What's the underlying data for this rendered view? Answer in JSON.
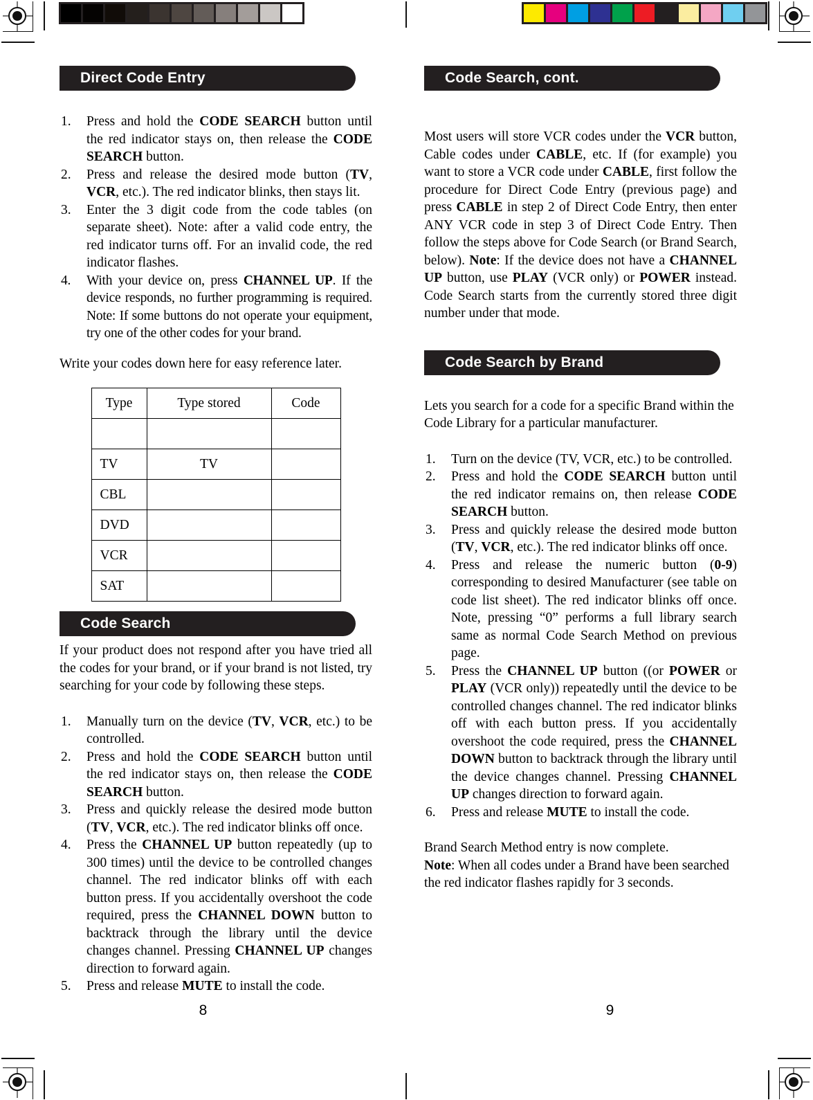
{
  "press": {
    "grayscale_patches": [
      "#000000",
      "#050302",
      "#110c08",
      "#241f1c",
      "#3b3430",
      "#4e4641",
      "#635c58",
      "#867f7c",
      "#a39d9a",
      "#cbc7c4",
      "#ffffff"
    ],
    "color_patches": [
      "#fdea00",
      "#e6007e",
      "#009fe3",
      "#2e3192",
      "#00a14b",
      "#ed1c24",
      "#231f20",
      "#fbeda0",
      "#f4a7c4",
      "#6fcff0",
      "#939598"
    ]
  },
  "left_page": {
    "page_number": "8",
    "sections": [
      {
        "heading": "Direct Code Entry",
        "steps": [
          {
            "num": "1.",
            "parts": [
              {
                "t": "Press and hold the ",
                "b": false
              },
              {
                "t": "CODE SEARCH",
                "b": true
              },
              {
                "t": " button until the red indicator stays on, then release the ",
                "b": false
              },
              {
                "t": "CODE SEARCH",
                "b": true
              },
              {
                "t": " button.",
                "b": false
              }
            ]
          },
          {
            "num": "2.",
            "parts": [
              {
                "t": "Press and release the desired mode button (",
                "b": false
              },
              {
                "t": "TV",
                "b": true
              },
              {
                "t": ", ",
                "b": false
              },
              {
                "t": "VCR",
                "b": true
              },
              {
                "t": ", etc.). The red indicator blinks, then stays lit.",
                "b": false
              }
            ]
          },
          {
            "num": "3.",
            "parts": [
              {
                "t": "Enter the 3 digit code from the code tables (on separate sheet). Note: after a valid code entry, the red indicator turns off.  For an invalid code, the red indicator flashes.",
                "b": false
              }
            ]
          },
          {
            "num": "4.",
            "parts": [
              {
                "t": "With your device on, press ",
                "b": false
              },
              {
                "t": "CHANNEL UP",
                "b": true
              },
              {
                "t": ". If the device responds, no further programming is required. Note: If some buttons do not operate your equipment, try one of the other codes for your brand.",
                "b": false
              }
            ]
          }
        ],
        "after_text": "Write your codes down here for easy reference later.",
        "table": {
          "headers": [
            "Type",
            "Type  stored",
            "Code"
          ],
          "rows": [
            [
              "",
              "",
              ""
            ],
            [
              "TV",
              "TV",
              ""
            ],
            [
              "CBL",
              "",
              ""
            ],
            [
              "DVD",
              "",
              ""
            ],
            [
              "VCR",
              "",
              ""
            ],
            [
              "SAT",
              "",
              ""
            ]
          ]
        }
      },
      {
        "heading": "Code Search",
        "intro": "If your product does not respond after you have tried all the codes for your brand, or if your brand is not listed, try searching for your code by following these steps.",
        "steps": [
          {
            "num": "1.",
            "parts": [
              {
                "t": "Manually turn on the device (",
                "b": false
              },
              {
                "t": "TV",
                "b": true
              },
              {
                "t": ", ",
                "b": false
              },
              {
                "t": "VCR",
                "b": true
              },
              {
                "t": ", etc.) to be controlled.",
                "b": false
              }
            ]
          },
          {
            "num": "2.",
            "parts": [
              {
                "t": "Press and hold the ",
                "b": false
              },
              {
                "t": "CODE SEARCH",
                "b": true
              },
              {
                "t": " button until the red indicator stays on, then release the ",
                "b": false
              },
              {
                "t": "CODE SEARCH",
                "b": true
              },
              {
                "t": " button.",
                "b": false
              }
            ]
          },
          {
            "num": "3.",
            "parts": [
              {
                "t": "Press and quickly release the desired mode button (",
                "b": false
              },
              {
                "t": "TV",
                "b": true
              },
              {
                "t": ", ",
                "b": false
              },
              {
                "t": "VCR",
                "b": true
              },
              {
                "t": ", etc.). The red indicator blinks off once.",
                "b": false
              }
            ]
          },
          {
            "num": "4.",
            "parts": [
              {
                "t": "Press the ",
                "b": false
              },
              {
                "t": "CHANNEL UP",
                "b": true
              },
              {
                "t": " button repeatedly (up to 300 times) until the device to be controlled changes channel. The red indicator blinks off with each button press.  If you accidentally overshoot the code required, press the ",
                "b": false
              },
              {
                "t": "CHANNEL DOWN",
                "b": true
              },
              {
                "t": " button to backtrack through the library until the device changes channel. Pressing ",
                "b": false
              },
              {
                "t": "CHANNEL UP",
                "b": true
              },
              {
                "t": " changes direction to forward again.",
                "b": false
              }
            ]
          },
          {
            "num": "5.",
            "parts": [
              {
                "t": "Press and release ",
                "b": false
              },
              {
                "t": "MUTE",
                "b": true
              },
              {
                "t": " to install the code.",
                "b": false
              }
            ]
          }
        ]
      }
    ]
  },
  "right_page": {
    "page_number": "9",
    "sections": [
      {
        "heading": "Code Search, cont.",
        "paragraph": [
          {
            "t": "Most users will store VCR codes under the ",
            "b": false
          },
          {
            "t": "VCR",
            "b": true
          },
          {
            "t": " button, Cable codes under ",
            "b": false
          },
          {
            "t": "CABLE",
            "b": true
          },
          {
            "t": ", etc. If (for example) you want to store a VCR code under ",
            "b": false
          },
          {
            "t": "CABLE",
            "b": true
          },
          {
            "t": ", first follow the procedure for Direct Code Entry (previous page) and press ",
            "b": false
          },
          {
            "t": "CABLE",
            "b": true
          },
          {
            "t": " in step 2 of Direct Code Entry, then enter ANY VCR code in step 3 of Direct Code Entry. Then follow the steps above for Code Search (or Brand Search, below). ",
            "b": false
          },
          {
            "t": "Note",
            "b": true
          },
          {
            "t": ":  If the device does not have a ",
            "b": false
          },
          {
            "t": "CHANNEL UP",
            "b": true
          },
          {
            "t": " button, use ",
            "b": false
          },
          {
            "t": "PLAY",
            "b": true
          },
          {
            "t": " (VCR only) or ",
            "b": false
          },
          {
            "t": "POWER",
            "b": true
          },
          {
            "t": " instead. Code Search starts from the currently stored three digit number under that mode.",
            "b": false
          }
        ]
      },
      {
        "heading": "Code Search by Brand",
        "intro": "Lets you search for a code for a specific Brand within the Code Library for a particular manufacturer.",
        "steps": [
          {
            "num": "1.",
            "parts": [
              {
                "t": "Turn on the device (TV, VCR, etc.) to be controlled.",
                "b": false
              }
            ]
          },
          {
            "num": "2.",
            "parts": [
              {
                "t": "Press and hold the ",
                "b": false
              },
              {
                "t": "CODE SEARCH",
                "b": true
              },
              {
                "t": " button until the red indicator remains on, then release ",
                "b": false
              },
              {
                "t": "CODE SEARCH",
                "b": true
              },
              {
                "t": " button.",
                "b": false
              }
            ]
          },
          {
            "num": "3.",
            "parts": [
              {
                "t": "Press and quickly release the desired mode button (",
                "b": false
              },
              {
                "t": "TV",
                "b": true
              },
              {
                "t": ", ",
                "b": false
              },
              {
                "t": "VCR",
                "b": true
              },
              {
                "t": ", etc.). The red indicator blinks off once.",
                "b": false
              }
            ]
          },
          {
            "num": "4.",
            "parts": [
              {
                "t": "Press and release the numeric button (",
                "b": false
              },
              {
                "t": "0-9",
                "b": true
              },
              {
                "t": ") corresponding to desired Manufacturer (see table on code list sheet).  The red indicator blinks off once. Note, pressing “0” performs a full library search same as normal Code Search Method on previous page.",
                "b": false
              }
            ]
          },
          {
            "num": "5.",
            "parts": [
              {
                "t": "Press the ",
                "b": false
              },
              {
                "t": "CHANNEL UP",
                "b": true
              },
              {
                "t": " button ((or ",
                "b": false
              },
              {
                "t": "POWER",
                "b": true
              },
              {
                "t": " or ",
                "b": false
              },
              {
                "t": "PLAY",
                "b": true
              },
              {
                "t": " (VCR only)) repeatedly until the device to be controlled changes channel. The red indicator blinks off with each button press. If you accidentally overshoot the code required, press the ",
                "b": false
              },
              {
                "t": "CHANNEL DOWN",
                "b": true
              },
              {
                "t": " button to backtrack through the library until the device changes channel. Pressing ",
                "b": false
              },
              {
                "t": "CHANNEL UP",
                "b": true
              },
              {
                "t": " changes direction to forward again.",
                "b": false
              }
            ]
          },
          {
            "num": "6.",
            "parts": [
              {
                "t": "Press and release ",
                "b": false
              },
              {
                "t": "MUTE",
                "b": true
              },
              {
                "t": " to install the code.",
                "b": false
              }
            ]
          }
        ],
        "closing": [
          {
            "t": "Brand Search Method entry is now complete.",
            "b": false
          },
          {
            "t": "\n",
            "b": false
          },
          {
            "t": "Note",
            "b": true
          },
          {
            "t": ": When all codes under a Brand have been searched the red indicator flashes rapidly for 3 seconds.",
            "b": false
          }
        ]
      }
    ]
  }
}
